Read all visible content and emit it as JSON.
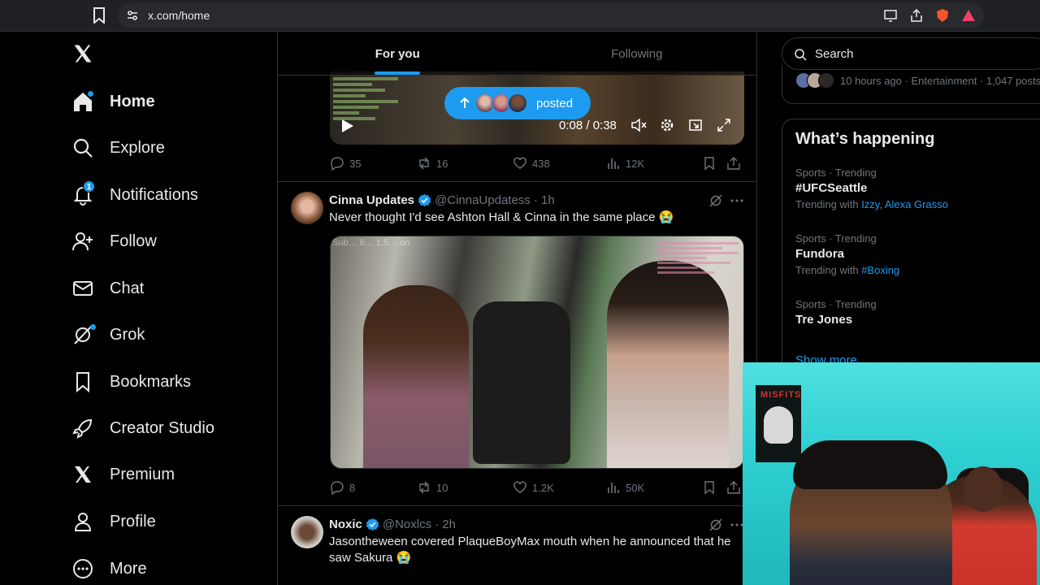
{
  "browser": {
    "url": "x.com/home"
  },
  "nav": {
    "items": [
      {
        "label": "Home"
      },
      {
        "label": "Explore"
      },
      {
        "label": "Notifications",
        "badge": "1"
      },
      {
        "label": "Follow"
      },
      {
        "label": "Chat"
      },
      {
        "label": "Grok"
      },
      {
        "label": "Bookmarks"
      },
      {
        "label": "Creator Studio"
      },
      {
        "label": "Premium"
      },
      {
        "label": "Profile"
      },
      {
        "label": "More"
      }
    ]
  },
  "feed": {
    "tabs": [
      {
        "label": "For you",
        "active": true
      },
      {
        "label": "Following",
        "active": false
      }
    ],
    "new_posts_pill": "posted",
    "video1": {
      "time": "0:08 / 0:38"
    },
    "post1_actions": {
      "replies": "35",
      "reposts": "16",
      "likes": "438",
      "views": "12K"
    },
    "post2": {
      "name": "Cinna Updates",
      "handle": "@CinnaUpdatess",
      "time": "· 1h",
      "text": "Never thought I'd see Ashton Hall & Cinna in the same place 😭",
      "watermark": "Sub… 6… 1.5… on",
      "actions": {
        "replies": "8",
        "reposts": "10",
        "likes": "1.2K",
        "views": "50K"
      }
    },
    "post3": {
      "name": "Noxic",
      "handle": "@Noxlcs",
      "time": "· 2h",
      "text": "Jasontheween covered PlaqueBoyMax mouth when he announced that he saw Sakura 😭"
    }
  },
  "sidebar": {
    "search_placeholder": "Search",
    "top_card_meta": "10 hours ago · Entertainment · 1,047 posts",
    "whats_happening_title": "What’s happening",
    "trends": [
      {
        "category": "Sports · Trending",
        "name": "#UFCSeattle",
        "with_label": "Trending with",
        "with_links": "Izzy, Alexa Grasso"
      },
      {
        "category": "Sports · Trending",
        "name": "Fundora",
        "with_label": "Trending with",
        "with_links": "#Boxing"
      },
      {
        "category": "Sports · Trending",
        "name": "Tre Jones",
        "with_label": "",
        "with_links": ""
      }
    ],
    "show_more": "Show more"
  },
  "webcam": {
    "poster_text": "MISFITS"
  },
  "colors": {
    "accent": "#1d9bf0",
    "background": "#000000",
    "border": "#2f3336",
    "muted_text": "#71767b"
  }
}
